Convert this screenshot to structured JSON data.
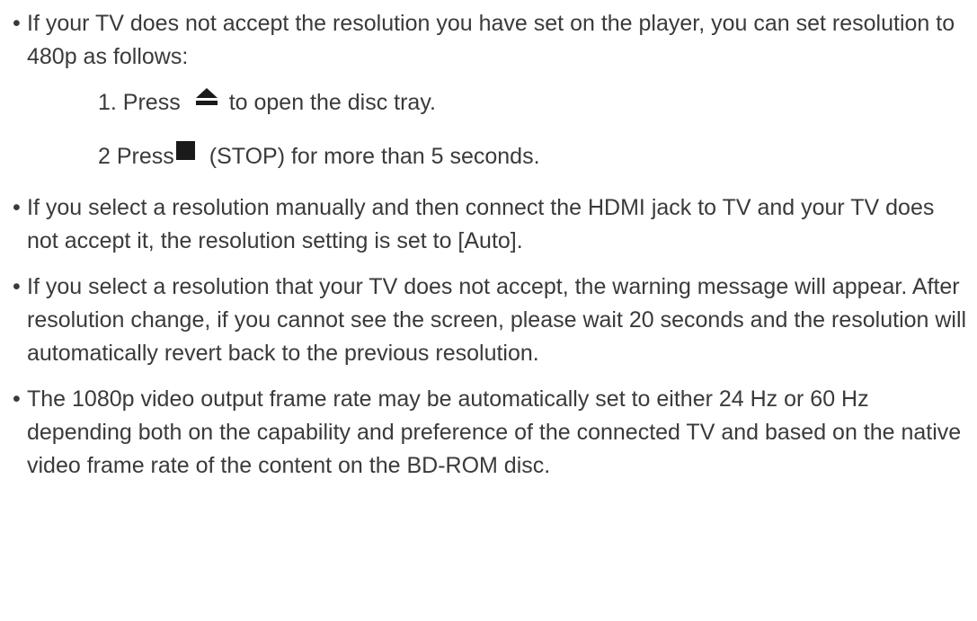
{
  "bullet_char": "•",
  "notes": [
    {
      "text": "If your TV does not accept the resolution you have set on the player, you can set resolution to 480p as follows:"
    },
    {
      "text": "If you select a resolution manually and then connect the HDMI jack to TV and your TV does not accept it, the resolution setting is set to [Auto]."
    },
    {
      "text": "If you select a resolution that your TV does not accept, the warning message will appear. After resolution change, if you cannot see the screen, please wait 20 seconds and the resolution will automatically revert back to the previous resolution."
    },
    {
      "text": "The 1080p video output frame rate may be automatically set to either 24 Hz or 60 Hz depending both on the capability and preference of the connected TV and based on the native video frame rate of the content on the BD-ROM disc."
    }
  ],
  "steps": [
    {
      "prefix": "1. Press",
      "icon": "eject-icon",
      "suffix": "to open the disc tray."
    },
    {
      "prefix": "2 Press",
      "icon": "stop-icon",
      "suffix": "(STOP) for more than 5 seconds."
    }
  ]
}
